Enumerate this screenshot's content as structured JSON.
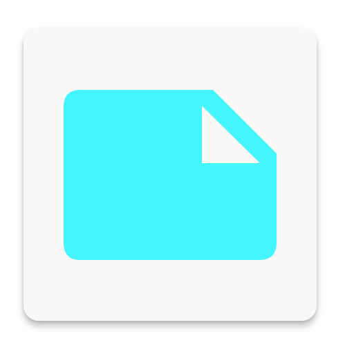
{
  "icon": {
    "name": "document-icon",
    "tile_color": "#faf7f7",
    "document_color": "#44f5fe",
    "fold_color": "#faf7f7"
  }
}
